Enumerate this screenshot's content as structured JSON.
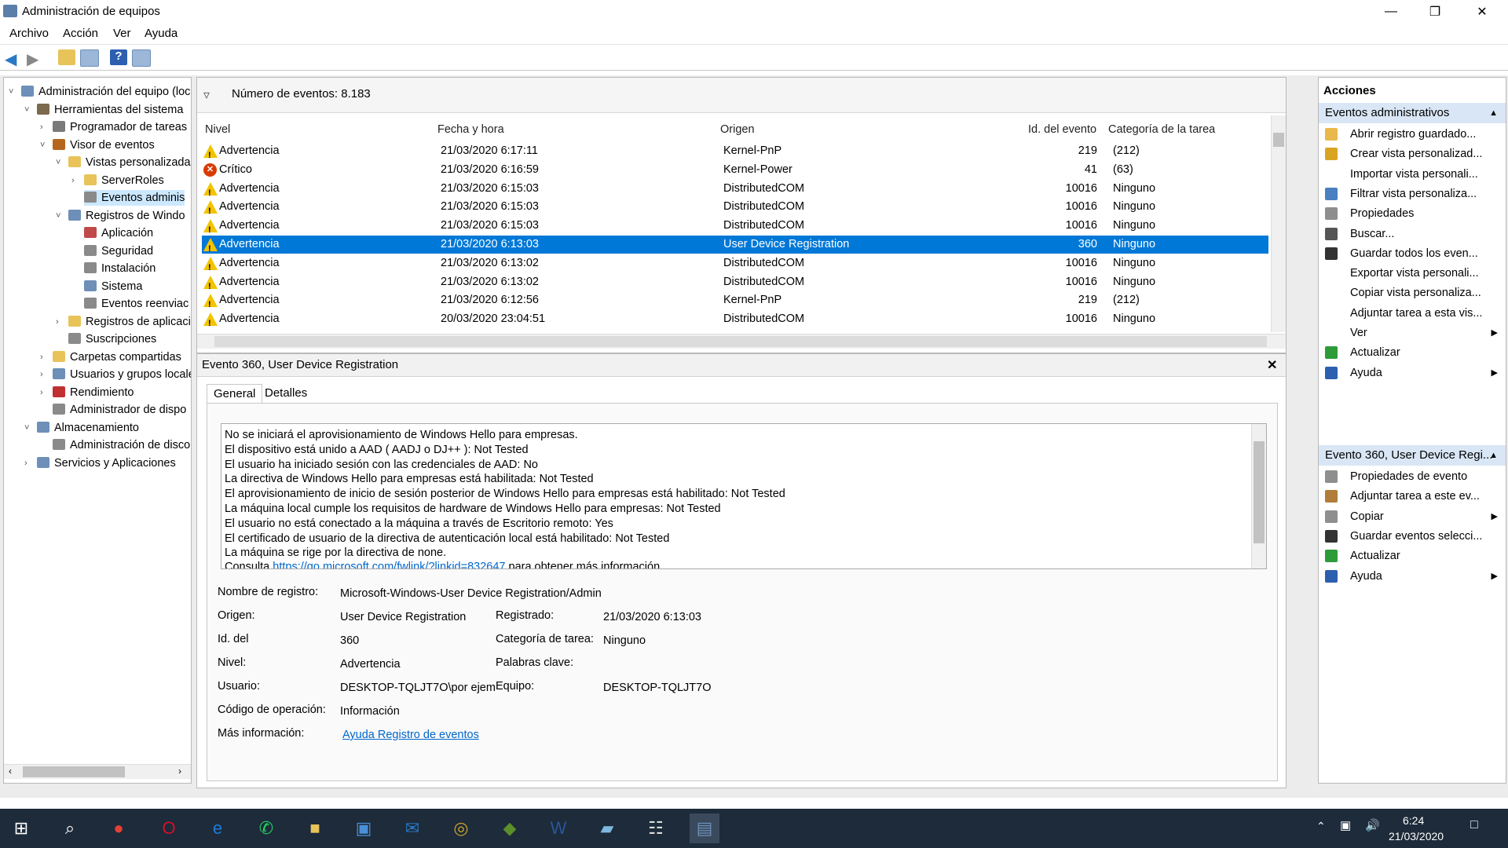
{
  "window": {
    "title": "Administración de equipos"
  },
  "menu": [
    "Archivo",
    "Acción",
    "Ver",
    "Ayuda"
  ],
  "tree": [
    {
      "label": "Administración del equipo (loca",
      "level": 0
    },
    {
      "label": "Herramientas del sistema",
      "level": 1
    },
    {
      "label": "Programador de tareas",
      "level": 2
    },
    {
      "label": "Visor de eventos",
      "level": 2
    },
    {
      "label": "Vistas personalizada",
      "level": 3
    },
    {
      "label": "ServerRoles",
      "level": 4
    },
    {
      "label": "Eventos adminis",
      "level": 4
    },
    {
      "label": "Registros de Windo",
      "level": 3
    },
    {
      "label": "Aplicación",
      "level": 4
    },
    {
      "label": "Seguridad",
      "level": 4
    },
    {
      "label": "Instalación",
      "level": 4
    },
    {
      "label": "Sistema",
      "level": 4
    },
    {
      "label": "Eventos reenviac",
      "level": 4
    },
    {
      "label": "Registros de aplicaci",
      "level": 3
    },
    {
      "label": "Suscripciones",
      "level": 3
    },
    {
      "label": "Carpetas compartidas",
      "level": 2
    },
    {
      "label": "Usuarios y grupos locale",
      "level": 2
    },
    {
      "label": "Rendimiento",
      "level": 2
    },
    {
      "label": "Administrador de dispo",
      "level": 2
    },
    {
      "label": "Almacenamiento",
      "level": 1
    },
    {
      "label": "Administración de disco",
      "level": 2
    },
    {
      "label": "Servicios y Aplicaciones",
      "level": 1
    }
  ],
  "events": {
    "count_label": "Número de eventos: 8.183",
    "columns": [
      "Nivel",
      "Fecha y hora",
      "Origen",
      "Id. del evento",
      "Categoría de la tarea"
    ],
    "rows": [
      {
        "level": "Advertencia",
        "date": "21/03/2020 6:17:11",
        "source": "Kernel-PnP",
        "id": "219",
        "category": "(212)",
        "type": "warn"
      },
      {
        "level": "Crítico",
        "date": "21/03/2020 6:16:59",
        "source": "Kernel-Power",
        "id": "41",
        "category": "(63)",
        "type": "crit"
      },
      {
        "level": "Advertencia",
        "date": "21/03/2020 6:15:03",
        "source": "DistributedCOM",
        "id": "10016",
        "category": "Ninguno",
        "type": "warn"
      },
      {
        "level": "Advertencia",
        "date": "21/03/2020 6:15:03",
        "source": "DistributedCOM",
        "id": "10016",
        "category": "Ninguno",
        "type": "warn"
      },
      {
        "level": "Advertencia",
        "date": "21/03/2020 6:15:03",
        "source": "DistributedCOM",
        "id": "10016",
        "category": "Ninguno",
        "type": "warn"
      },
      {
        "level": "Advertencia",
        "date": "21/03/2020 6:13:03",
        "source": "User Device Registration",
        "id": "360",
        "category": "Ninguno",
        "type": "warn",
        "selected": true
      },
      {
        "level": "Advertencia",
        "date": "21/03/2020 6:13:02",
        "source": "DistributedCOM",
        "id": "10016",
        "category": "Ninguno",
        "type": "warn"
      },
      {
        "level": "Advertencia",
        "date": "21/03/2020 6:13:02",
        "source": "DistributedCOM",
        "id": "10016",
        "category": "Ninguno",
        "type": "warn"
      },
      {
        "level": "Advertencia",
        "date": "21/03/2020 6:12:56",
        "source": "Kernel-PnP",
        "id": "219",
        "category": "(212)",
        "type": "warn"
      },
      {
        "level": "Advertencia",
        "date": "20/03/2020 23:04:51",
        "source": "DistributedCOM",
        "id": "10016",
        "category": "Ninguno",
        "type": "warn"
      }
    ]
  },
  "detail": {
    "title": "Evento 360, User Device Registration",
    "tabs": [
      "General",
      "Detalles"
    ],
    "message_lines": [
      "No se iniciará el aprovisionamiento de Windows Hello para empresas.",
      "El dispositivo está unido a AAD ( AADJ o DJ++ ): Not Tested",
      "El usuario ha iniciado sesión con las credenciales de AAD: No",
      "La directiva de Windows Hello para empresas está habilitada: Not Tested",
      "El aprovisionamiento de inicio de sesión posterior de Windows Hello para empresas está habilitado: Not Tested",
      "La máquina local cumple los requisitos de hardware de Windows Hello para empresas: Not Tested",
      "El usuario no está conectado a la máquina a través de Escritorio remoto: Yes",
      "El certificado de usuario de la directiva de autenticación local está habilitado: Not Tested",
      "La máquina se rige por la directiva de none."
    ],
    "message_more_prefix": "Consulta",
    "message_more_link": "https://go.microsoft.com/fwlink/?linkid=832647",
    "message_more_suffix": "para obtener más información.",
    "props": {
      "log_name_label": "Nombre de registro:",
      "log_name": "Microsoft-Windows-User Device Registration/Admin",
      "source_label": "Origen:",
      "source": "User Device Registration",
      "logged_label": "Registrado:",
      "logged": "21/03/2020 6:13:03",
      "id_label": "Id. del",
      "id": "360",
      "task_label": "Categoría de tarea:",
      "task": "Ninguno",
      "level_label": "Nivel:",
      "level": "Advertencia",
      "keywords_label": "Palabras clave:",
      "user_label": "Usuario:",
      "user": "DESKTOP-TQLJT7O\\por ejem",
      "computer_label": "Equipo:",
      "computer": "DESKTOP-TQLJT7O",
      "opcode_label": "Código de operación:",
      "opcode": "Información",
      "more_label": "Más información:",
      "more_link": "Ayuda Registro de eventos"
    }
  },
  "actions": {
    "header": "Acciones",
    "section1": "Eventos administrativos",
    "items1": [
      {
        "label": "Abrir registro guardado...",
        "icon": "folder-icon",
        "color": "#e8b84a"
      },
      {
        "label": "Crear vista personalizad...",
        "icon": "filter-icon",
        "color": "#d9a520"
      },
      {
        "label": "Importar vista personali...",
        "icon": "",
        "color": ""
      },
      {
        "label": "Filtrar vista personaliza...",
        "icon": "filter-icon",
        "color": "#4a7fc0"
      },
      {
        "label": "Propiedades",
        "icon": "properties-icon",
        "color": "#8e8e8e"
      },
      {
        "label": "Buscar...",
        "icon": "binoculars-icon",
        "color": "#555555"
      },
      {
        "label": "Guardar todos los even...",
        "icon": "save-icon",
        "color": "#333333"
      },
      {
        "label": "Exportar vista personali...",
        "icon": "",
        "color": ""
      },
      {
        "label": "Copiar vista personaliza...",
        "icon": "",
        "color": ""
      },
      {
        "label": "Adjuntar tarea a esta vis...",
        "icon": "",
        "color": ""
      },
      {
        "label": "Ver",
        "icon": "",
        "color": "",
        "submenu": true
      },
      {
        "label": "Actualizar",
        "icon": "refresh-icon",
        "color": "#2e9b3a"
      },
      {
        "label": "Ayuda",
        "icon": "help-icon",
        "color": "#2d5fb0",
        "submenu": true
      }
    ],
    "section2": "Evento 360, User Device Regi...",
    "items2": [
      {
        "label": "Propiedades de evento",
        "icon": "properties-icon",
        "color": "#8e8e8e"
      },
      {
        "label": "Adjuntar tarea a este ev...",
        "icon": "task-icon",
        "color": "#b07d3a"
      },
      {
        "label": "Copiar",
        "icon": "copy-icon",
        "color": "#8e8e8e",
        "submenu": true
      },
      {
        "label": "Guardar eventos selecci...",
        "icon": "save-icon",
        "color": "#333333"
      },
      {
        "label": "Actualizar",
        "icon": "refresh-icon",
        "color": "#2e9b3a"
      },
      {
        "label": "Ayuda",
        "icon": "help-icon",
        "color": "#2d5fb0",
        "submenu": true
      }
    ]
  },
  "taskbar": {
    "time": "6:24",
    "date": "21/03/2020",
    "apps": [
      "start-icon",
      "search-icon",
      "chrome-icon",
      "opera-icon",
      "edge-icon",
      "whatsapp-icon",
      "explorer-icon",
      "store-icon",
      "mail-icon",
      "app-icon",
      "xbox-icon",
      "word-icon",
      "eraser-icon",
      "calculator-icon",
      "computer-management-icon"
    ]
  }
}
